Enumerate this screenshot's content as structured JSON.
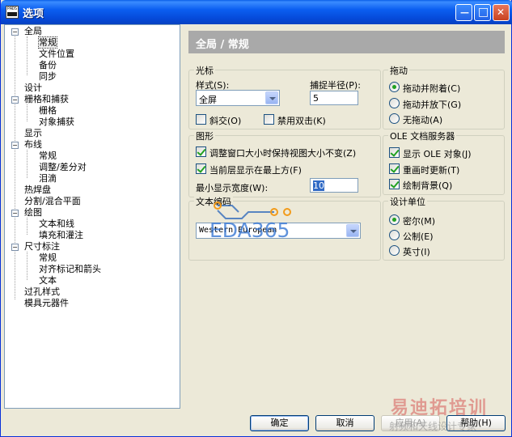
{
  "window": {
    "title": "选项",
    "icon_text": "PADS",
    "min_glyph": "—",
    "max_glyph": "□",
    "close_glyph": "✕"
  },
  "tree": {
    "items": [
      {
        "label": "全局",
        "expander": "−"
      },
      {
        "label": "常规",
        "selected": true
      },
      {
        "label": "文件位置"
      },
      {
        "label": "备份"
      },
      {
        "label": "同步"
      },
      {
        "label": "设计"
      },
      {
        "label": "栅格和捕获",
        "expander": "−"
      },
      {
        "label": "栅格"
      },
      {
        "label": "对象捕获"
      },
      {
        "label": "显示"
      },
      {
        "label": "布线",
        "expander": "−"
      },
      {
        "label": "常规"
      },
      {
        "label": "调整/差分对"
      },
      {
        "label": "泪滴"
      },
      {
        "label": "热焊盘"
      },
      {
        "label": "分割/混合平面"
      },
      {
        "label": "绘图",
        "expander": "−"
      },
      {
        "label": "文本和线"
      },
      {
        "label": "填充和灌注"
      },
      {
        "label": "尺寸标注",
        "expander": "−"
      },
      {
        "label": "常规"
      },
      {
        "label": "对齐标记和箭头"
      },
      {
        "label": "文本"
      },
      {
        "label": "过孔样式"
      },
      {
        "label": "模具元器件"
      }
    ]
  },
  "header": {
    "title": "全局 / 常规"
  },
  "cursor": {
    "group_title": "光标",
    "style_label": "样式(S):",
    "style_value": "全屏",
    "snap_label": "捕捉半径(P):",
    "snap_value": "5",
    "ortho_label": "斜交(O)",
    "ortho_checked": false,
    "disable_dblclick_label": "禁用双击(K)",
    "disable_dblclick_checked": false
  },
  "graphics": {
    "group_title": "图形",
    "keep_view_label": "调整窗口大小时保持视图大小不变(Z)",
    "keep_view_checked": true,
    "current_layer_label": "当前层显示在最上方(F)",
    "current_layer_checked": true,
    "min_width_label": "最小显示宽度(W):",
    "min_width_value": "10"
  },
  "text_encoding": {
    "group_title": "文本编码",
    "value": "Western European"
  },
  "drag": {
    "group_title": "拖动",
    "options": [
      {
        "label": "拖动并附着(C)",
        "selected": true
      },
      {
        "label": "拖动并放下(G)",
        "selected": false
      },
      {
        "label": "无拖动(A)",
        "selected": false
      }
    ]
  },
  "ole": {
    "group_title": "OLE 文档服务器",
    "options": [
      {
        "label": "显示 OLE 对象(J)",
        "checked": true
      },
      {
        "label": "重画时更新(T)",
        "checked": true
      },
      {
        "label": "绘制背景(Q)",
        "checked": true
      }
    ]
  },
  "units": {
    "group_title": "设计单位",
    "options": [
      {
        "label": "密尔(M)",
        "selected": true
      },
      {
        "label": "公制(E)",
        "selected": false
      },
      {
        "label": "英寸(I)",
        "selected": false
      }
    ]
  },
  "buttons": {
    "ok": "确定",
    "cancel": "取消",
    "apply": "应用(A)",
    "help": "帮助(H)"
  },
  "watermark": {
    "eda": "EDA365",
    "cn": "易迪拓培训",
    "sub": "射频和天线设计专家"
  },
  "colors": {
    "title_bar": "#0b5ef0",
    "header_bar": "#a9a9a9",
    "dialog_bg": "#ece9d8",
    "check_green": "#21a121",
    "selection_blue": "#316ac5"
  }
}
